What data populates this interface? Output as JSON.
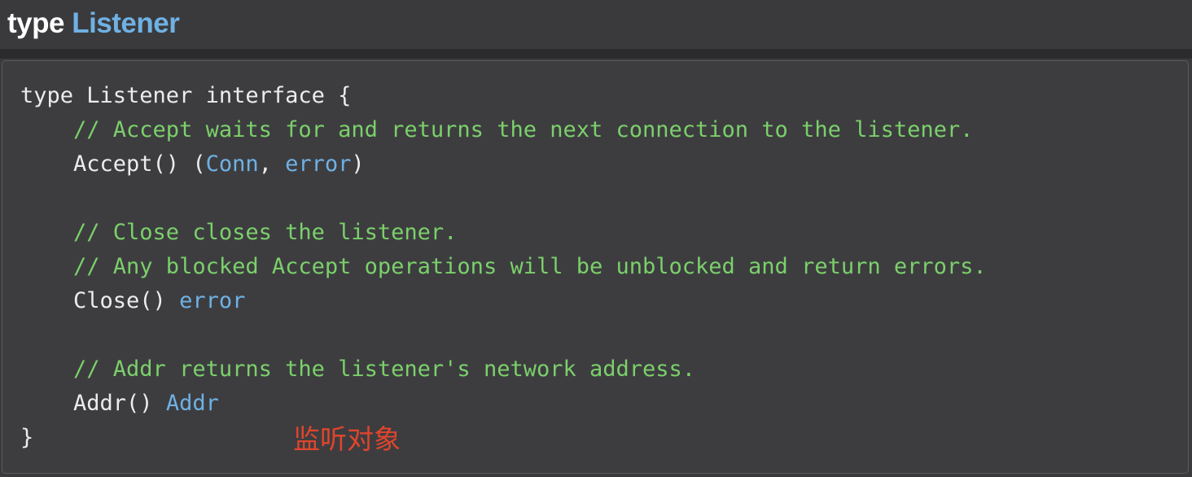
{
  "header": {
    "keyword": "type",
    "name": "Listener"
  },
  "code": {
    "line1": "type Listener interface {",
    "line2_comment": "    // Accept waits for and returns the next connection to the listener.",
    "line3_pre": "    Accept() (",
    "line3_type1": "Conn",
    "line3_sep": ", ",
    "line3_type2": "error",
    "line3_post": ")",
    "line5_comment": "    // Close closes the listener.",
    "line6_comment": "    // Any blocked Accept operations will be unblocked and return errors.",
    "line7_pre": "    Close() ",
    "line7_type": "error",
    "line9_comment": "    // Addr returns the listener's network address.",
    "line10_pre": "    Addr() ",
    "line10_type": "Addr",
    "line11": "}"
  },
  "annotation": "监听对象",
  "colors": {
    "comment": "#7bd06a",
    "type": "#6fb1e4",
    "annotation": "#e0452c",
    "background": "#3a3a3c"
  }
}
